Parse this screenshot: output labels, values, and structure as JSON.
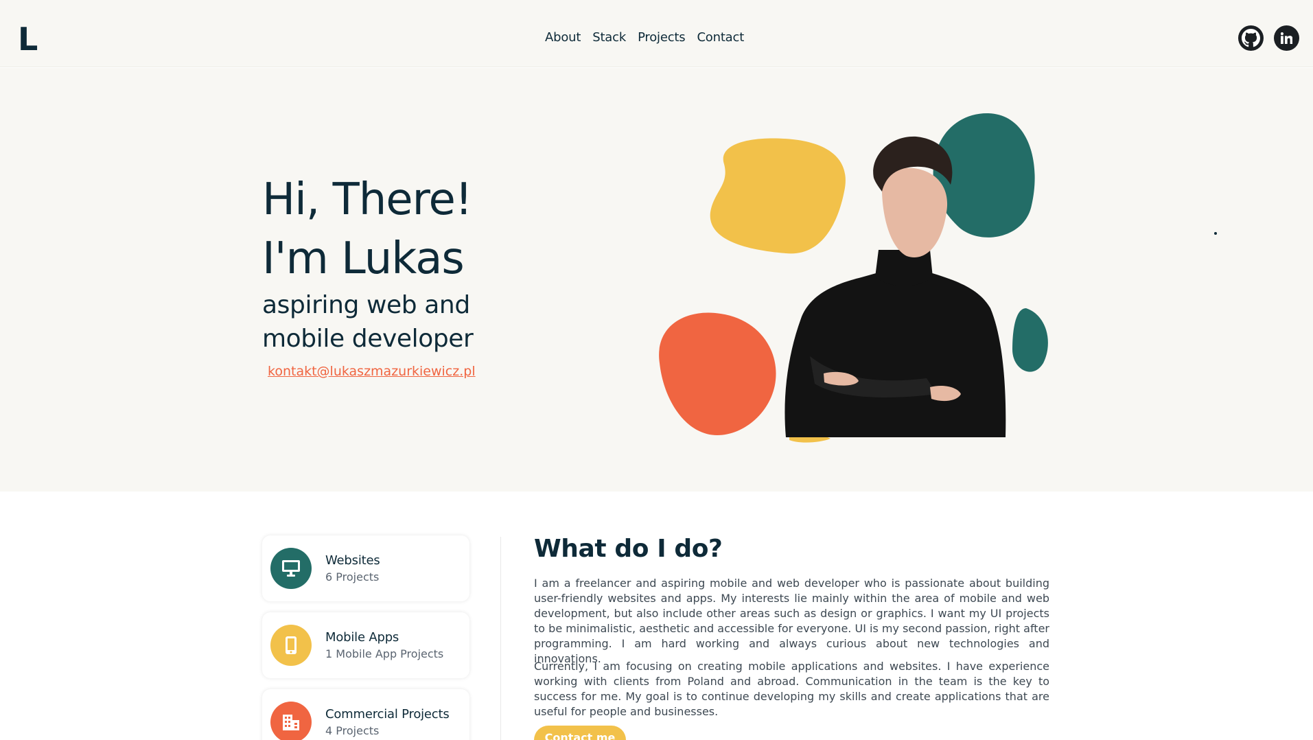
{
  "header": {
    "logo": "L",
    "nav": [
      "About",
      "Stack",
      "Projects",
      "Contact"
    ],
    "social": [
      "github-icon",
      "linkedin-icon"
    ]
  },
  "hero": {
    "line1": "Hi, There!",
    "line2": "I'm Lukas",
    "subtitle": "aspiring web and mobile developer",
    "email": "kontakt@lukaszmazurkiewicz.pl"
  },
  "services": [
    {
      "title": "Websites",
      "subtitle": "6 Projects",
      "icon": "desktop-icon",
      "color": "#236d67"
    },
    {
      "title": "Mobile Apps",
      "subtitle": "1 Mobile App Projects",
      "icon": "phone-icon",
      "color": "#f2c14a"
    },
    {
      "title": "Commercial Projects",
      "subtitle": "4 Projects",
      "icon": "building-icon",
      "color": "#f06541"
    }
  ],
  "about": {
    "title": "What do I do?",
    "p1": "I am a freelancer and aspiring mobile and web developer who is passionate about building user-friendly websites and apps. My interests lie mainly within the area of mobile and web development, but also include other areas such as design or graphics. I want my UI projects to be minimalistic, aesthetic and accessible for everyone. UI is my second passion, right after programming. I am hard working and always curious about new technologies and innovations.",
    "p2": "Currently, I am focusing on creating mobile applications and websites. I have experience working with clients from Poland and abroad. Communication in the team is the key to success for me. My goal is to continue developing my skills and create applications that are useful for people and businesses.",
    "cta": "Contact me"
  },
  "colors": {
    "navy": "#0e2a38",
    "teal": "#236d67",
    "yellow": "#f2c14a",
    "orange": "#f06541",
    "cream": "#f8f7f3"
  }
}
